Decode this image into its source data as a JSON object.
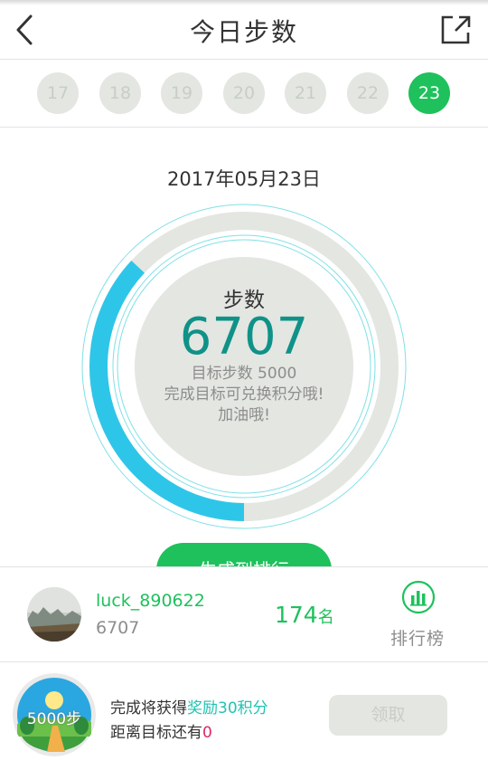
{
  "header": {
    "title": "今日步数",
    "back_icon": "chevron-left-icon",
    "share_icon": "share-external-icon"
  },
  "days": [
    {
      "label": "17",
      "active": false
    },
    {
      "label": "18",
      "active": false
    },
    {
      "label": "19",
      "active": false
    },
    {
      "label": "20",
      "active": false
    },
    {
      "label": "21",
      "active": false
    },
    {
      "label": "22",
      "active": false
    },
    {
      "label": "23",
      "active": true
    }
  ],
  "date": "2017年05月23日",
  "progress": {
    "label": "步数",
    "steps": "6707",
    "goal_text": "目标步数 5000",
    "hint1": "完成目标可兑换积分哦!",
    "hint2": "加油哦!",
    "arc_fraction": 0.37,
    "colors": {
      "track": "#e3e6e1",
      "arc": "#2ec6e8",
      "steps": "#0f9288"
    }
  },
  "green_button_label": "生成到排行",
  "user": {
    "name": "luck_890622",
    "steps": "6707",
    "rank_number": "174",
    "rank_unit": "名",
    "leaderboard_label": "排行榜",
    "leaderboard_icon": "bar-chart-icon"
  },
  "reward": {
    "badge_text": "5000步",
    "line1_prefix": "完成将获得",
    "line1_highlight": "奖励30积分",
    "line2_prefix": "距离目标还有",
    "line2_value": "0",
    "claim_label": "领取"
  },
  "colors": {
    "accent": "#1ec15c",
    "teal": "#21c3b1",
    "pink": "#e02666"
  }
}
